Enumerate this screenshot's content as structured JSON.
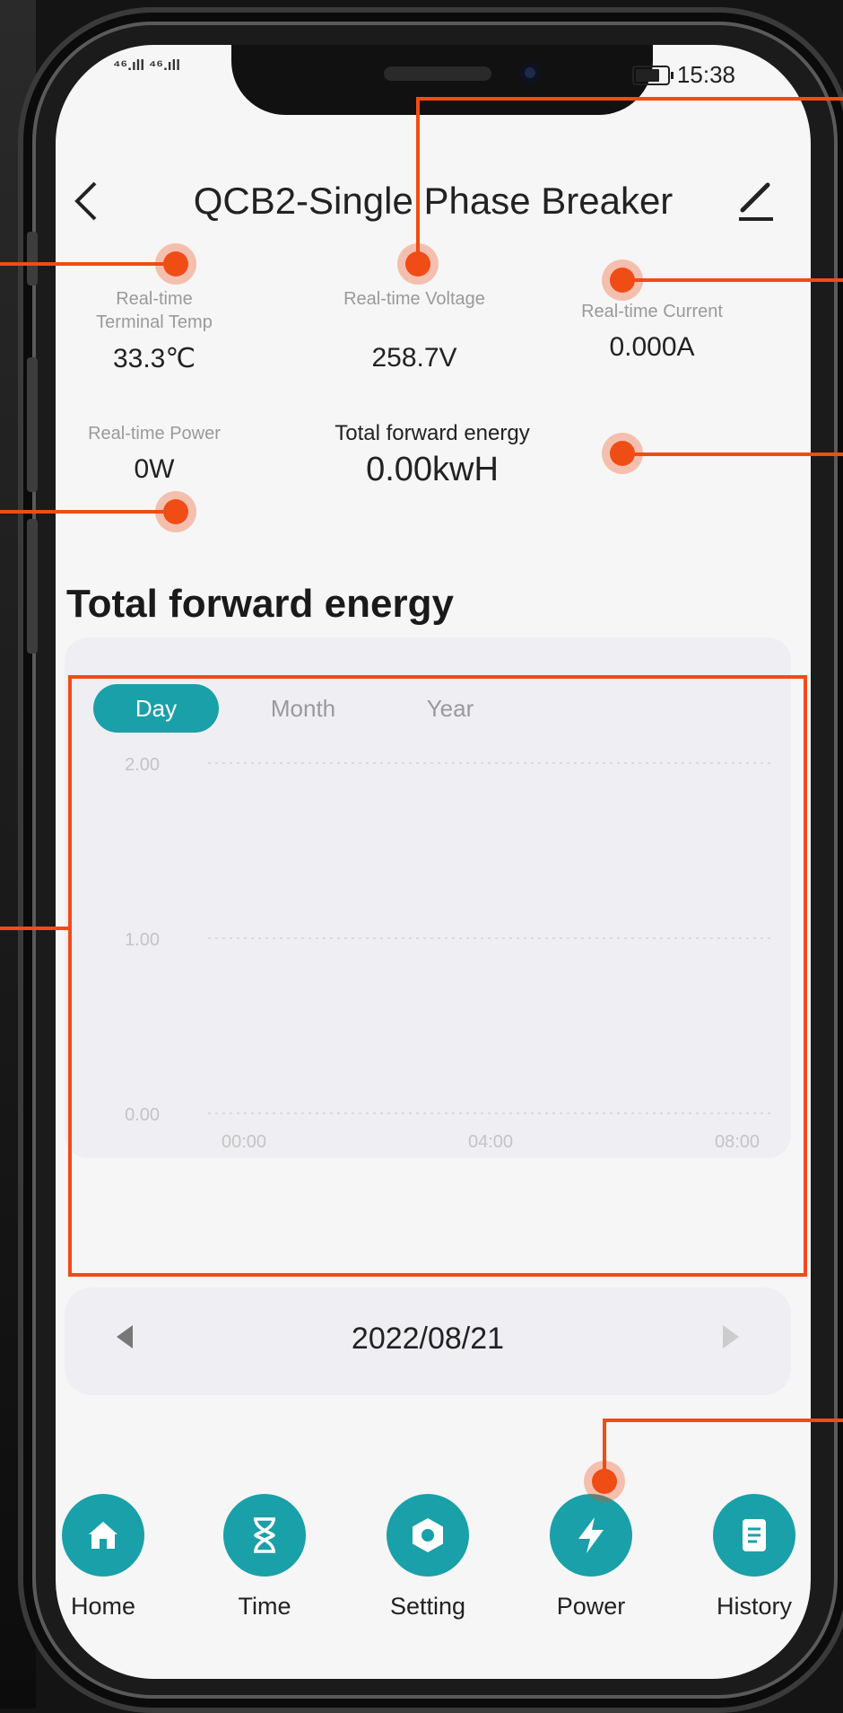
{
  "status_bar": {
    "signal": "⁴⁶.ıll ⁴⁶.ıll",
    "time": "15:38"
  },
  "header": {
    "title": "QCB2-Single Phase Breaker",
    "back_icon": "chevron-left-icon",
    "edit_icon": "pencil-icon"
  },
  "metrics": {
    "terminal_temp": {
      "label_line1": "Real-time",
      "label_line2": "Terminal Temp",
      "value": "33.3℃"
    },
    "voltage": {
      "label": "Real-time Voltage",
      "value": "258.7V"
    },
    "current": {
      "label": "Real-time Current",
      "value": "0.000A"
    },
    "power": {
      "label": "Real-time Power",
      "value": "0W"
    },
    "forward_energy": {
      "label": "Total forward energy",
      "value": "0.00kwH"
    }
  },
  "section": {
    "title": "Total forward energy"
  },
  "chart_tabs": [
    {
      "label": "Day",
      "active": true
    },
    {
      "label": "Month",
      "active": false
    },
    {
      "label": "Year",
      "active": false
    }
  ],
  "chart_data": {
    "type": "line",
    "y_ticks": [
      "2.00",
      "1.00",
      "0.00"
    ],
    "x_ticks": [
      "00:00",
      "04:00",
      "08:00"
    ],
    "ylim": [
      0,
      2
    ],
    "series": [],
    "grid": "dotted horizontal"
  },
  "date_nav": {
    "date": "2022/08/21",
    "prev_icon": "triangle-left-icon",
    "next_icon": "triangle-right-icon"
  },
  "bottom_nav": [
    {
      "label": "Home",
      "icon": "home-icon"
    },
    {
      "label": "Time",
      "icon": "hourglass-icon"
    },
    {
      "label": "Setting",
      "icon": "hex-nut-icon"
    },
    {
      "label": "Power",
      "icon": "lightning-icon"
    },
    {
      "label": "History",
      "icon": "document-icon"
    }
  ],
  "colors": {
    "accent": "#1aa0a8",
    "callout": "#f04c16",
    "screen_bg": "#f6f6f6"
  }
}
